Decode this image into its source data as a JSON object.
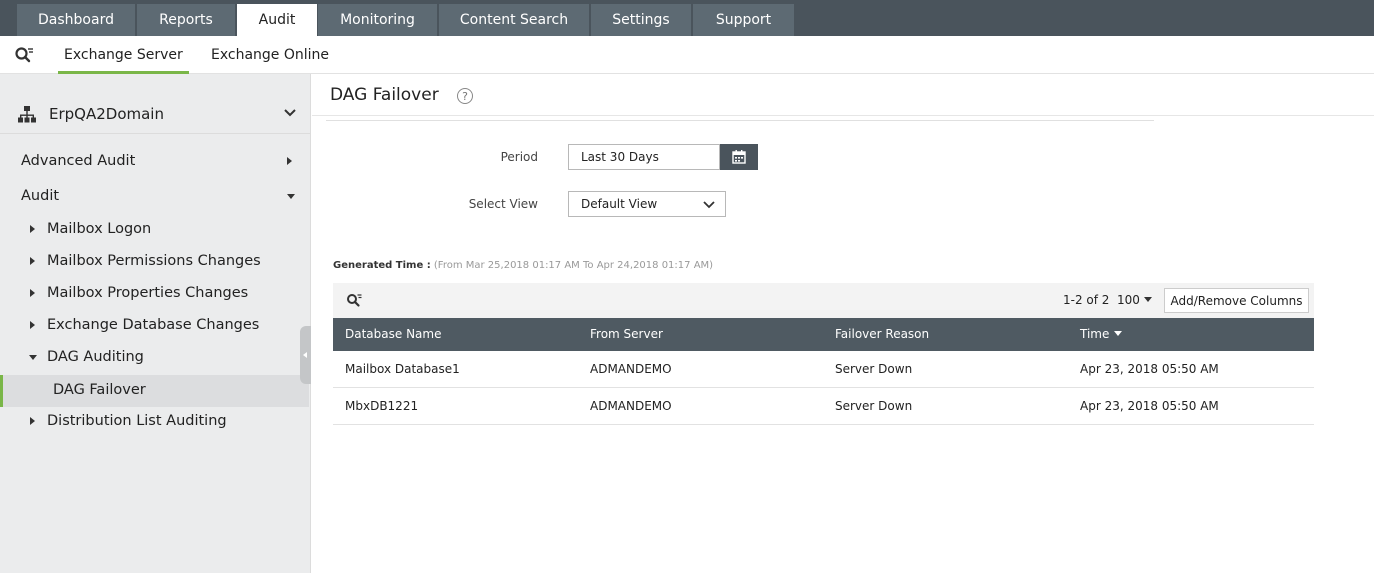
{
  "topnav": {
    "tabs": [
      {
        "label": "Dashboard"
      },
      {
        "label": "Reports"
      },
      {
        "label": "Audit"
      },
      {
        "label": "Monitoring"
      },
      {
        "label": "Content Search"
      },
      {
        "label": "Settings"
      },
      {
        "label": "Support"
      }
    ],
    "active": "Audit"
  },
  "subnav": {
    "tabs": [
      {
        "label": "Exchange Server"
      },
      {
        "label": "Exchange Online"
      }
    ],
    "active": "Exchange Server"
  },
  "sidebar": {
    "domain": "ErpQA2Domain",
    "items": [
      {
        "label": "Advanced Audit"
      },
      {
        "label": "Audit"
      },
      {
        "label": "Mailbox Logon"
      },
      {
        "label": "Mailbox Permissions Changes"
      },
      {
        "label": "Mailbox Properties Changes"
      },
      {
        "label": "Exchange Database Changes"
      },
      {
        "label": "DAG Auditing"
      },
      {
        "label": "DAG Failover"
      },
      {
        "label": "Distribution List Auditing"
      }
    ],
    "selected": "DAG Failover"
  },
  "main": {
    "title": "DAG Failover",
    "help_glyph": "?",
    "form": {
      "period_label": "Period",
      "period_value": "Last 30 Days",
      "view_label": "Select View",
      "view_value": "Default View"
    },
    "generated": {
      "label": "Generated Time :",
      "range": "(From Mar 25,2018 01:17 AM To Apr 24,2018 01:17 AM)"
    },
    "table": {
      "pager": "1-2 of 2",
      "per_page": "100",
      "add_remove_label": "Add/Remove Columns",
      "columns": [
        "Database Name",
        "From Server",
        "Failover Reason",
        "Time"
      ],
      "rows": [
        [
          "Mailbox Database1",
          "ADMANDEMO",
          "Server Down",
          "Apr 23, 2018 05:50 AM"
        ],
        [
          "MbxDB1221",
          "ADMANDEMO",
          "Server Down",
          "Apr 23, 2018 05:50 AM"
        ]
      ]
    }
  },
  "colors": {
    "topnav_bg": "#4a545c",
    "tab_bg": "#5d6a73",
    "accent_green": "#7ab648",
    "table_header_bg": "#4f5a62",
    "sidebar_bg": "#ebeced"
  }
}
